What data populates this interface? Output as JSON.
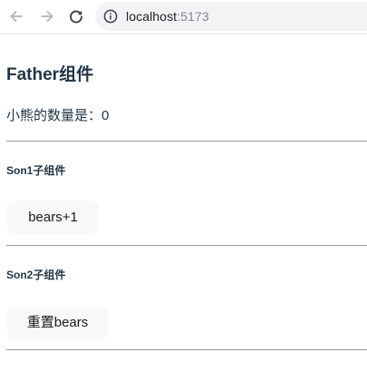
{
  "browser": {
    "url_host": "localhost",
    "url_port": ":5173"
  },
  "father": {
    "title": "Father组件",
    "count_label": "小熊的数量是：",
    "count_value": "0"
  },
  "son1": {
    "title": "Son1子组件",
    "button_label": "bears+1"
  },
  "son2": {
    "title": "Son2子组件",
    "button_label": "重置bears"
  },
  "icons": {
    "back": "arrow-left-icon",
    "forward": "arrow-right-icon",
    "reload": "reload-icon",
    "info": "info-icon"
  },
  "colors": {
    "text": "#213547",
    "button_bg": "#f9f9f9",
    "divider": "#9a9a9a"
  }
}
